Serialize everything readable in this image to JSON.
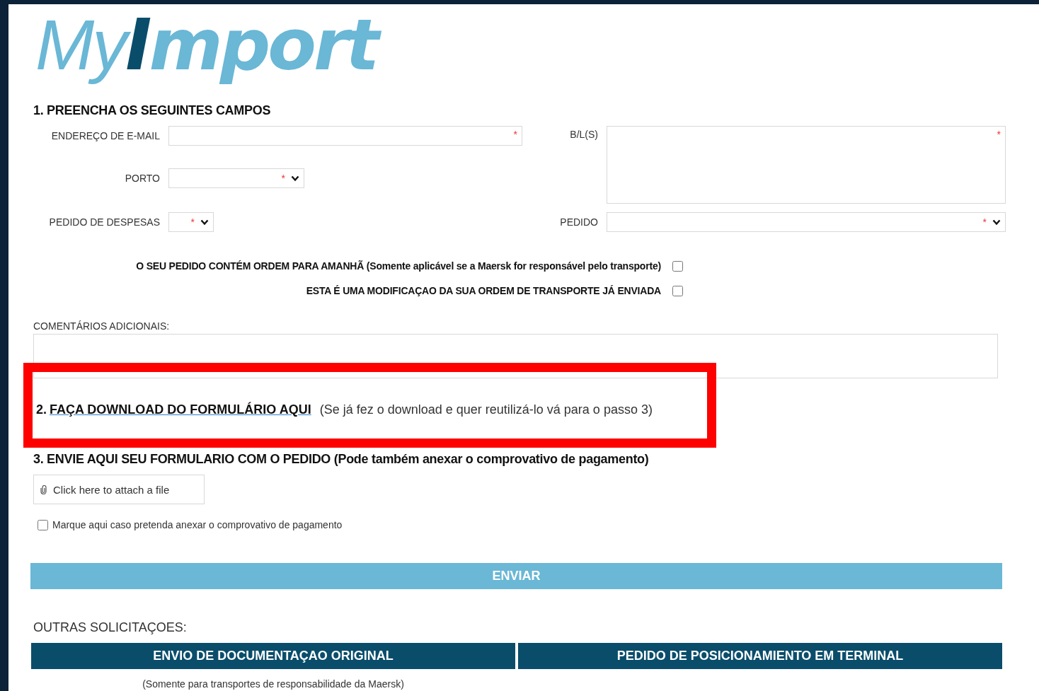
{
  "logo": {
    "parts": [
      {
        "text": "My",
        "color": "#6ab7d6"
      },
      {
        "text": "I",
        "color": "#0a4d6b"
      },
      {
        "text": "mport",
        "color": "#6ab7d6"
      }
    ]
  },
  "section_1": {
    "title": "1. PREENCHA OS SEGUINTES CAMPOS",
    "fields": [
      {
        "label": "ENDEREÇO DE E-MAIL",
        "kind": "text",
        "marker": "*"
      },
      {
        "label": "B/L(S)",
        "kind": "textarea",
        "marker": "*"
      },
      {
        "label": "PORTO",
        "kind": "select",
        "marker": "*"
      },
      {
        "label": "PEDIDO DE DESPESAS",
        "kind": "select",
        "marker": "*"
      },
      {
        "label": "PEDIDO",
        "kind": "select",
        "marker": "*"
      }
    ],
    "checks": [
      {
        "label": "O SEU PEDIDO CONTÉM ORDEM PARA AMANHÃ (Somente aplicável se a Maersk for responsável pelo transporte)",
        "checked": false
      },
      {
        "label": "ESTA É UMA MODIFICAÇAO DA SUA ORDEM DE TRANSPORTE JÁ ENVIADA",
        "checked": false
      }
    ],
    "comments_label": "COMENTÁRIOS ADICIONAIS:"
  },
  "section_2": {
    "number": "2.",
    "link": "FAÇA DOWNLOAD DO FORMULÁRIO AQUI",
    "note": "(Se já fez o download e quer reutilizá-lo vá para o passo 3)"
  },
  "section_3": {
    "title": "3. ENVIE AQUI SEU FORMULARIO COM O PEDIDO (Pode também anexar o comprovativo de pagamento)",
    "attach_button": "Click here to attach a file",
    "check": {
      "label": "Marque aqui caso pretenda anexar o comprovativo de pagamento",
      "checked": false
    }
  },
  "submit": "ENVIAR",
  "other_requests": {
    "title": "OUTRAS SOLICITAÇOES:",
    "buttons": [
      {
        "label": "ENVIO DE DOCUMENTAÇAO ORIGINAL",
        "note": "(Somente para transportes de responsabilidade da Maersk)"
      },
      {
        "label": "PEDIDO DE POSICIONAMIENTO EM TERMINAL"
      }
    ]
  }
}
